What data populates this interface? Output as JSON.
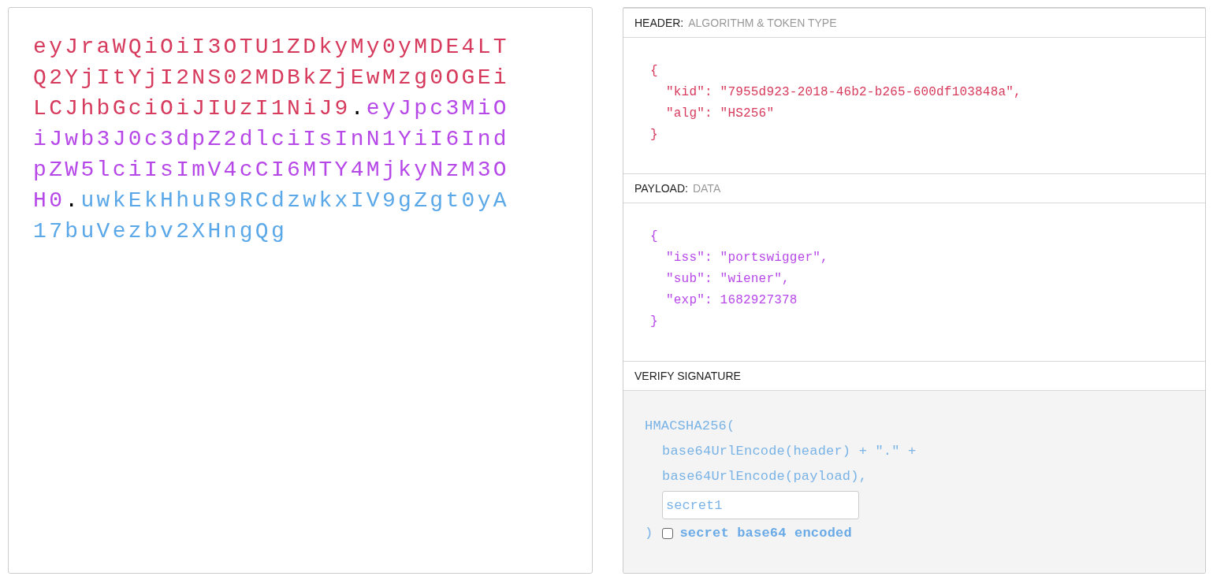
{
  "encoded_token": [
    {
      "kind": "header",
      "text": "eyJraWQiOiI3OTU1ZDkyMy0yMDE4LTQ2YjItYjI2NS02MDBkZjEwMzg0OGEiLCJhbGciOiJIUzI1NiJ9"
    },
    {
      "kind": "dot",
      "text": "."
    },
    {
      "kind": "payload",
      "text": "eyJpc3MiOiJwb3J0c3dpZ2dlciIsInN1YiI6IndpZW5lciIsImV4cCI6MTY4MjkyNzM3OH0"
    },
    {
      "kind": "dot",
      "text": "."
    },
    {
      "kind": "signature",
      "text": "uwkEkHhuR9RCdzwkxIV9gZgt0yA17buVezbv2XHngQg"
    }
  ],
  "header": {
    "title": "HEADER:",
    "subtitle": "ALGORITHM & TOKEN TYPE",
    "open": "{",
    "entries": [
      "\"kid\": \"7955d923-2018-46b2-b265-600df103848a\",",
      "\"alg\": \"HS256\""
    ],
    "close": "}"
  },
  "payload": {
    "title": "PAYLOAD:",
    "subtitle": "DATA",
    "open": "{",
    "entries": [
      "\"iss\": \"portswigger\",",
      "\"sub\": \"wiener\",",
      "\"exp\": 1682927378"
    ],
    "close": "}"
  },
  "verify_signature": {
    "title": "VERIFY SIGNATURE",
    "function": "HMACSHA256(",
    "arguments": [
      "base64UrlEncode(header) + \".\" +",
      "base64UrlEncode(payload),"
    ],
    "secret": "secret1",
    "close": ")",
    "base64_checkbox": {
      "label": "secret base64 encoded",
      "checked": false
    }
  }
}
